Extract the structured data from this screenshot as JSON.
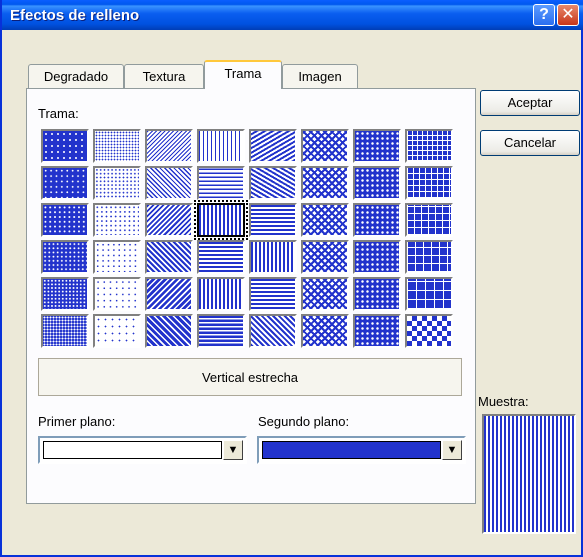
{
  "dialog": {
    "title": "Efectos de relleno",
    "help_glyph": "?",
    "close_glyph": "✕"
  },
  "tabs": [
    {
      "label": "Degradado",
      "active": false
    },
    {
      "label": "Textura",
      "active": false
    },
    {
      "label": "Trama",
      "active": true
    },
    {
      "label": "Imagen",
      "active": false
    }
  ],
  "trama": {
    "label": "Trama:",
    "selected_index": 19,
    "selected_name": "Vertical estrecha",
    "patterns": [
      "dots-5",
      "dots-10",
      "dots-20",
      "dots-25",
      "dots-30",
      "dots-40",
      "dots-50",
      "dots-60",
      "dots-70",
      "dots-75",
      "dots-80",
      "dots-90",
      "light-down-diag",
      "light-up-diag",
      "dark-down-diag",
      "dark-up-diag",
      "wide-down-diag",
      "wide-up-diag",
      "light-vertical",
      "light-horizontal",
      "narrow-vertical",
      "narrow-horizontal",
      "dark-vertical",
      "dark-horizontal",
      "dashed-down-diag",
      "dashed-up-diag",
      "dashed-horizontal",
      "dashed-vertical",
      "small-confetti",
      "large-confetti",
      "zigzag",
      "wave",
      "diagonal-brick",
      "horizontal-brick",
      "weave",
      "plaid",
      "divot",
      "dotted-grid",
      "dotted-diamond",
      "shingle",
      "trellis",
      "sphere",
      "small-grid",
      "large-grid",
      "small-checker",
      "large-checker",
      "outlined-diamond",
      "solid-diamond"
    ]
  },
  "colors": {
    "primer_plano_label": "Primer plano:",
    "segundo_plano_label": "Segundo plano:",
    "foreground": "#FFFFFF",
    "background": "#2233CC",
    "dropdown_glyph": "▼"
  },
  "buttons": {
    "accept": "Aceptar",
    "cancel": "Cancelar"
  },
  "muestra_label": "Muestra:"
}
